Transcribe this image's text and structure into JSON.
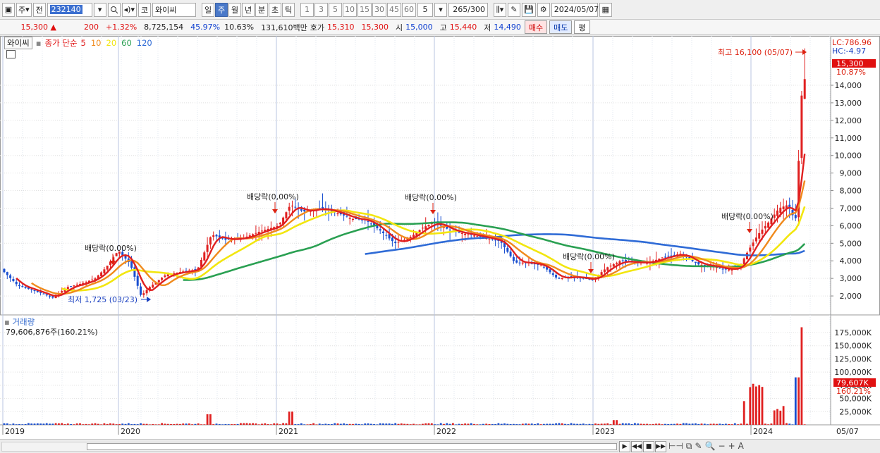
{
  "toolbar": {
    "type_label": "주",
    "prefix_label": "전",
    "code": "232140",
    "market_label": "코",
    "name": "와이씨",
    "periods": [
      {
        "label": "일",
        "active": false
      },
      {
        "label": "주",
        "active": true
      },
      {
        "label": "월",
        "active": false
      },
      {
        "label": "년",
        "active": false
      },
      {
        "label": "분",
        "active": false
      },
      {
        "label": "초",
        "active": false
      },
      {
        "label": "틱",
        "active": false
      }
    ],
    "intervals": [
      "1",
      "3",
      "5",
      "10",
      "15",
      "30",
      "45",
      "60"
    ],
    "interval_value": "5",
    "count": "265",
    "count_total": "/300",
    "date": "2024/05/07"
  },
  "quote": {
    "price": "15,300",
    "change": "200",
    "change_pct": "+1.32%",
    "volume": "8,725,154",
    "ratio1": "45.97%",
    "ratio2": "10.63%",
    "amount": "131,610백만",
    "bid_label": "호가",
    "bid1": "15,310",
    "bid2": "15,300",
    "open_label": "시",
    "open": "15,000",
    "high_label": "고",
    "high": "15,440",
    "low_label": "저",
    "low": "14,490",
    "buy": "매수",
    "sell": "매도",
    "eval": "평"
  },
  "legend": {
    "name": "와이씨",
    "ma_title": "종가 단순",
    "ma": [
      {
        "period": "5",
        "color": "#e02020"
      },
      {
        "period": "10",
        "color": "#f08a1c"
      },
      {
        "period": "20",
        "color": "#f2e60f"
      },
      {
        "period": "60",
        "color": "#2aa052"
      },
      {
        "period": "120",
        "color": "#2f6bd6"
      }
    ]
  },
  "volume_panel": {
    "title": "거래량",
    "value": "79,606,876주(160.21%)",
    "axis": [
      "175,000K",
      "150,000K",
      "125,000K",
      "100,000K",
      "75,000K",
      "50,000K",
      "25,000K"
    ],
    "marker_value": "79,607K",
    "marker_pct": "160.21%"
  },
  "chart_data": {
    "type": "candlestick",
    "price_axis": [
      "14,000",
      "13,000",
      "12,000",
      "11,000",
      "10,000",
      "9,000",
      "8,000",
      "7,000",
      "6,000",
      "5,000",
      "4,000",
      "3,000",
      "2,000"
    ],
    "ylim": [
      1000,
      16300
    ],
    "x_labels": [
      "2019",
      "2020",
      "2021",
      "2022",
      "2023",
      "2024"
    ],
    "x_end_label": "05/07",
    "current_price": "15,300",
    "current_pct": "10.87%",
    "lc": "LC:786.96",
    "hc": "HC:-4.97",
    "high_annotation": "최고 16,100 (05/07)",
    "low_annotation": "최저 1,725 (03/23)",
    "dividend_labels": [
      "배당락(0.00%)",
      "배당락(0,00%)",
      "배당락(0.00%)",
      "배당락(0.00%)",
      "배당락(0.00%)"
    ],
    "ma5_color": "#e02020",
    "ma10_color": "#f08a1c",
    "ma20_color": "#f2e60f",
    "ma60_color": "#2aa052",
    "ma120_color": "#2f6bd6",
    "up_color": "#e02020",
    "down_color": "#1a4fd0"
  }
}
